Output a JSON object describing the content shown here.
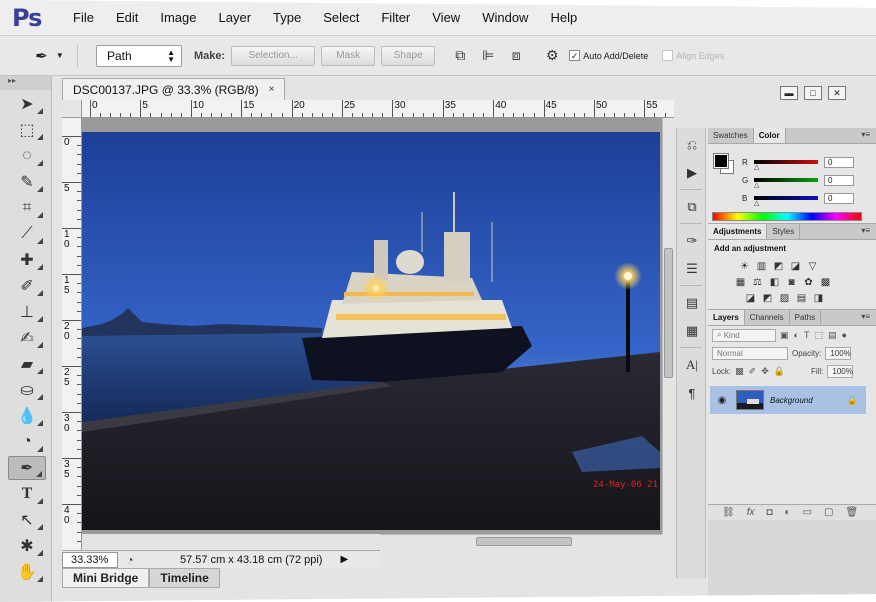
{
  "app": {
    "logo": "Ps",
    "menu": [
      "File",
      "Edit",
      "Image",
      "Layer",
      "Type",
      "Select",
      "Filter",
      "View",
      "Window",
      "Help"
    ]
  },
  "options": {
    "mode_value": "Path",
    "make_label": "Make:",
    "selection_btn": "Selection...",
    "mask_btn": "Mask",
    "shape_btn": "Shape",
    "auto_add_delete": "Auto Add/Delete",
    "align_edges": "Align Edges"
  },
  "window_controls": {
    "minimize": "▬",
    "maximize": "□",
    "close": "✕"
  },
  "document": {
    "tab_title": "DSC00137.JPG @ 33.3% (RGB/8)",
    "tab_close": "×",
    "date_stamp": "24-May-06 21",
    "ruler_top_labels": [
      "0",
      "5",
      "10",
      "15",
      "20",
      "25",
      "30",
      "35",
      "40",
      "45",
      "50",
      "55"
    ],
    "ruler_left_labels": [
      "0",
      "5",
      "10",
      "15",
      "20",
      "25",
      "30",
      "35",
      "40",
      "4"
    ]
  },
  "status": {
    "zoom": "33.33%",
    "doc_size": "57.57 cm x 43.18 cm (72 ppi)",
    "arrow": "▶"
  },
  "bottom_tabs": [
    "Mini Bridge",
    "Timeline"
  ],
  "panels": {
    "color_tabs": [
      "Swatches",
      "Color"
    ],
    "color_active": "Color",
    "channels": [
      {
        "label": "R",
        "value": "0",
        "color": "#d01010"
      },
      {
        "label": "G",
        "value": "0",
        "color": "#10a010"
      },
      {
        "label": "B",
        "value": "0",
        "color": "#1010c0"
      }
    ],
    "adjust_tabs": [
      "Adjustments",
      "Styles"
    ],
    "adjust_title": "Add an adjustment",
    "layers_tabs": [
      "Layers",
      "Channels",
      "Paths"
    ],
    "kind_label": "Kind",
    "blend_mode": "Normal",
    "opacity_label": "Opacity:",
    "opacity_value": "100%",
    "lock_label": "Lock:",
    "fill_label": "Fill:",
    "fill_value": "100%",
    "layer_name": "Background"
  },
  "colors": {
    "ps_logo": "#3a3f9a",
    "layer_selected": "#a9c2e4",
    "date_stamp": "#e02020"
  }
}
